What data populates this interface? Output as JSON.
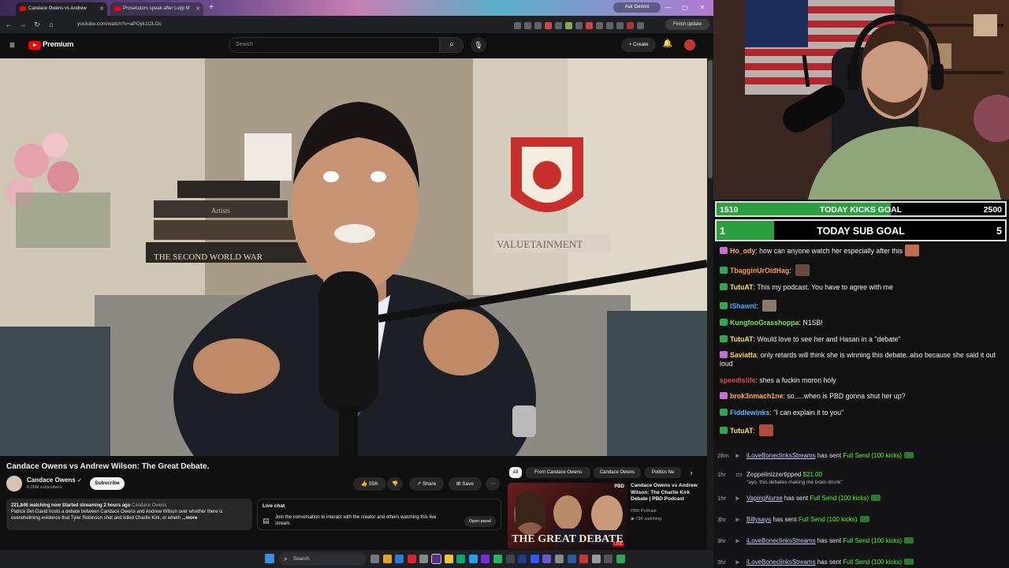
{
  "browser": {
    "tabs": [
      {
        "label": "Candace Owens vs Andrew"
      },
      {
        "label": "Prosecutors speak after Luigi M"
      }
    ],
    "new_tab_label": "+",
    "ask_gemini": "Ask Gemini",
    "url": "youtube.com/watch?v=aPOyk1i2LOc",
    "finish_update": "Finish update"
  },
  "youtube": {
    "logo_text": "Premium",
    "search_placeholder": "Search",
    "create_label": "Create",
    "video_title": "Candace Owens vs Andrew Wilson: The Great Debate.",
    "channel": {
      "name": "Candace Owens",
      "subs": "6.06M subscribers"
    },
    "subscribe_label": "Subscribe",
    "likes": "55K",
    "share_label": "Share",
    "save_label": "Save",
    "description": {
      "stats": "221,846 watching now  Started streaming 2 hours ago",
      "channel_tag": "Candace Owens",
      "text": "Patrick Bet-David hosts a debate between Candace Owens and Andrew Wilson over whether there is overwhelming evidence that Tyler Robinson shot and killed Charlie Kirk, or wheth",
      "more": "...more"
    },
    "live_chat": {
      "label": "Live chat",
      "join_text": "Join the conversation to interact with the creator and others watching this live stream.",
      "open_panel": "Open panel"
    },
    "chips": [
      "All",
      "From Candace Owens",
      "Candace Owens",
      "Politics Ne"
    ],
    "recommended": {
      "title": "Candace Owens vs Andrew Wilson: The Charlie Kirk Debate | PBD Podcast",
      "channel": "PBD Podcast",
      "watching": "73K watching",
      "thumb_text": "THE GREAT DEBATE",
      "live_badge": "LIVE",
      "thumb_logo": "PBD"
    },
    "video_overlay": {
      "book_spine_1": "THE SECOND WORLD WAR",
      "book_spine_2": "Artists",
      "sign_text": "VALUETAINMENT"
    }
  },
  "taskbar": {
    "search_placeholder": "Search"
  },
  "stream": {
    "goals": [
      {
        "left": "1510",
        "label": "TODAY KICKS GOAL",
        "right": "2500",
        "progress": 0.604
      },
      {
        "left": "1",
        "label": "TODAY SUB GOAL",
        "right": "5",
        "progress": 0.2
      }
    ],
    "chat": [
      {
        "user": "Ho_ody",
        "text": "how can anyone watch her especially after this",
        "color": "#ffb13d"
      },
      {
        "user": "TbagginUrOldHag",
        "text": "",
        "color": "#ff9a3d"
      },
      {
        "user": "TutuAT",
        "text": "This my podcast. You have to agree with me",
        "color": "#ffe14d"
      },
      {
        "user": "lShawnl",
        "text": "",
        "color": "#4da6ff"
      },
      {
        "user": "KungfooGrasshoppa",
        "text": "N1SB!",
        "color": "#7fe14d"
      },
      {
        "user": "TutuAT",
        "text": "Would love to see her and Hasan in a \"debate\"",
        "color": "#ffe14d"
      },
      {
        "user": "Saviatta",
        "text": "only retards will think she is winning this debate..also because she said it out loud",
        "color": "#ffd24d"
      },
      {
        "user": "speedislife",
        "text": "shes a fuckin moron holy",
        "color": "#e0484a"
      },
      {
        "user": "brok3nmach1ne",
        "text": "so.....when is PBD gonna shut her up?",
        "color": "#ffb13d"
      },
      {
        "user": "Fiddlewinks",
        "text": "\"I can explain it to you\"",
        "color": "#5fb3ff"
      },
      {
        "user": "TutuAT",
        "text": "",
        "color": "#ffe14d"
      }
    ],
    "activity": [
      {
        "time": "28m",
        "user": "iLoveBoneclinksStreams",
        "action": "has sent",
        "item": "Full Send (100 kicks)"
      },
      {
        "time": "1hr",
        "user": "Zeppelinizzer",
        "action": "tipped",
        "item": "$21.00",
        "note": "\"ayo, this debates making me brain drunk\""
      },
      {
        "time": "1hr",
        "user": "VapingNurse",
        "action": "has sent",
        "item": "Full Send (100 kicks)"
      },
      {
        "time": "3hr",
        "user": "Billysays",
        "action": "has sent",
        "item": "Full Send (100 kicks)"
      },
      {
        "time": "3hr",
        "user": "iLoveBoneclinksStreams",
        "action": "has sent",
        "item": "Full Send (100 kicks)"
      },
      {
        "time": "3hr",
        "user": "iLoveBoneclinksStreams",
        "action": "has sent",
        "item": "Full Send (100 kicks)"
      }
    ]
  }
}
